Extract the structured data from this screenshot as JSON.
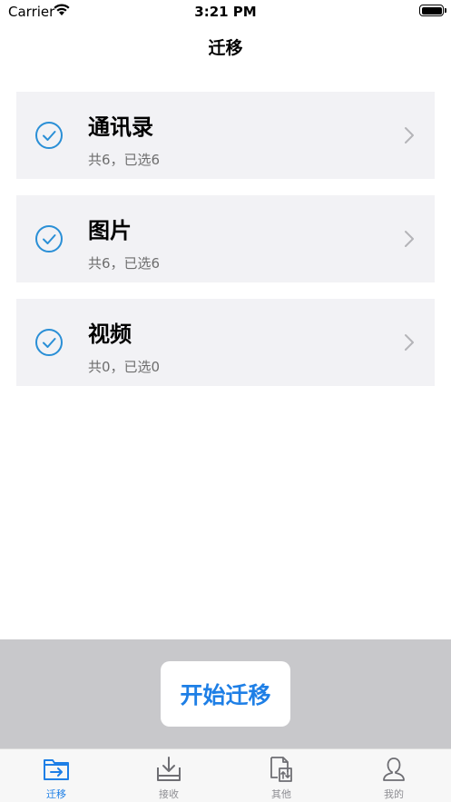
{
  "status_bar": {
    "carrier": "Carrier",
    "time": "3:21 PM"
  },
  "nav": {
    "title": "迁移"
  },
  "items": [
    {
      "title": "通讯录",
      "subtitle": "共6，已选6",
      "checked": true
    },
    {
      "title": "图片",
      "subtitle": "共6，已选6",
      "checked": true
    },
    {
      "title": "视频",
      "subtitle": "共0，已选0",
      "checked": true
    }
  ],
  "action": {
    "start_label": "开始迁移"
  },
  "tabs": [
    {
      "label": "迁移",
      "icon": "migrate-icon",
      "active": true
    },
    {
      "label": "接收",
      "icon": "receive-icon",
      "active": false
    },
    {
      "label": "其他",
      "icon": "other-icon",
      "active": false
    },
    {
      "label": "我的",
      "icon": "profile-icon",
      "active": false
    }
  ],
  "colors": {
    "accent": "#1e7fe6",
    "check": "#2a8fd6",
    "card_bg": "#f2f2f5",
    "panel_bg": "#c8c8cb",
    "inactive": "#8e8e93"
  }
}
